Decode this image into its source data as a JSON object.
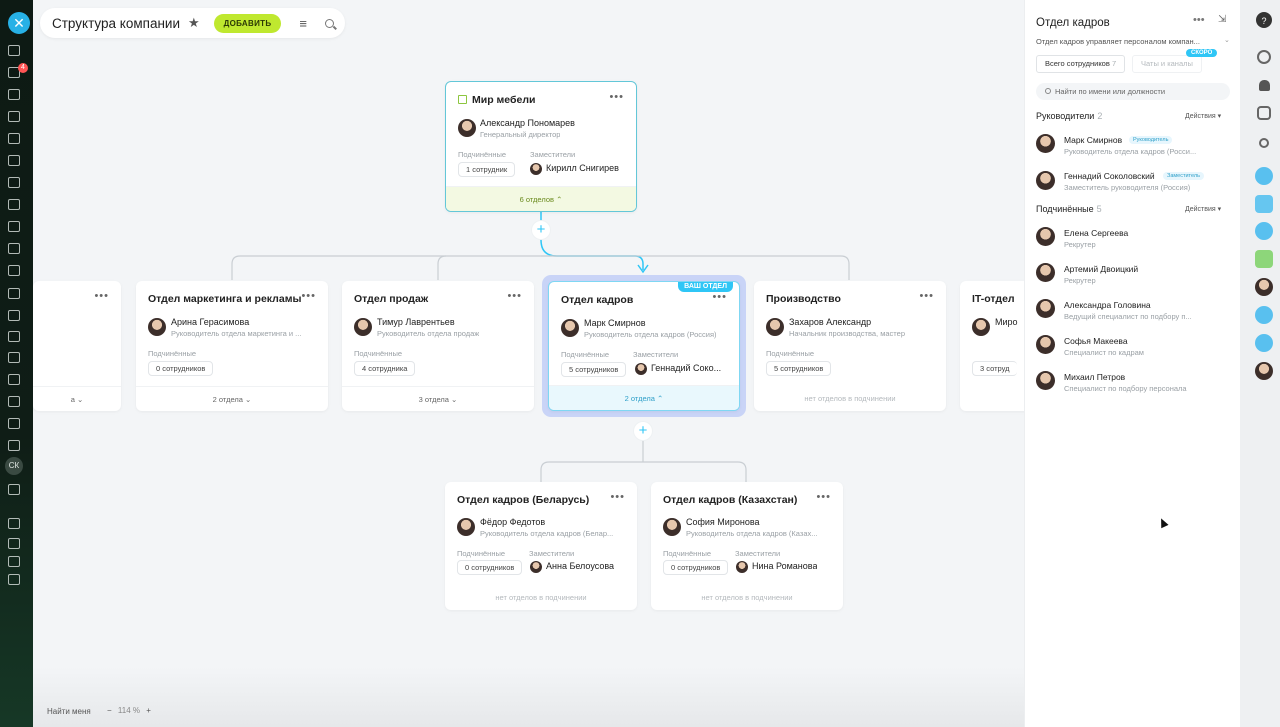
{
  "header": {
    "title": "Структура компании",
    "add_label": "ДОБАВИТЬ"
  },
  "cards": {
    "root": {
      "title": "Мир мебели",
      "head_name": "Александр Пономарев",
      "head_role": "Генеральный директор",
      "subs_label": "Подчинённые",
      "subs_value": "1 сотрудник",
      "deputy_label": "Заместители",
      "deputy_name": "Кирилл Снигирев",
      "footer": "6 отделов"
    },
    "partial": {
      "footer": "а"
    },
    "marketing": {
      "title": "Отдел маркетинга и рекламы",
      "head_name": "Арина Герасимова",
      "head_role": "Руководитель отдела маркетинга и ...",
      "subs_label": "Подчинённые",
      "subs_value": "0 сотрудников",
      "footer": "2 отдела"
    },
    "sales": {
      "title": "Отдел продаж",
      "head_name": "Тимур Лаврентьев",
      "head_role": "Руководитель отдела продаж",
      "subs_label": "Подчинённые",
      "subs_value": "4 сотрудника",
      "footer": "3 отдела"
    },
    "hr": {
      "badge": "ВАШ ОТДЕЛ",
      "title": "Отдел кадров",
      "head_name": "Марк Смирнов",
      "head_role": "Руководитель отдела кадров (Россия)",
      "subs_label": "Подчинённые",
      "subs_value": "5 сотрудников",
      "deputy_label": "Заместители",
      "deputy_name": "Геннадий Соко...",
      "footer": "2 отдела"
    },
    "production": {
      "title": "Производство",
      "head_name": "Захаров Александр",
      "head_role": "Начальник производства, мастер",
      "subs_label": "Подчинённые",
      "subs_value": "5 сотрудников",
      "footer": "нет отделов в подчинении"
    },
    "it": {
      "title": "IT-отдел",
      "head_name": "Миро",
      "subs_value": "3 сотруд"
    },
    "hr_by": {
      "title": "Отдел кадров (Беларусь)",
      "head_name": "Фёдор Федотов",
      "head_role": "Руководитель отдела кадров (Белар...",
      "subs_label": "Подчинённые",
      "subs_value": "0 сотрудников",
      "deputy_label": "Заместители",
      "deputy_name": "Анна Белоусова",
      "footer": "нет отделов в подчинении"
    },
    "hr_kz": {
      "title": "Отдел кадров (Казахстан)",
      "head_name": "София Миронова",
      "head_role": "Руководитель отдела кадров (Казах...",
      "subs_label": "Подчинённые",
      "subs_value": "0 сотрудников",
      "deputy_label": "Заместители",
      "deputy_name": "Нина Романова",
      "footer": "нет отделов в подчинении"
    }
  },
  "bottom": {
    "find_me": "Найти меня",
    "zoom_minus": "−",
    "zoom_value": "114 %",
    "zoom_plus": "+"
  },
  "left_rail": {
    "badge_count": "4",
    "user_initials": "СК"
  },
  "panel": {
    "title": "Отдел кадров",
    "description": "Отдел кадров управляет персоналом компан...",
    "tab_all": "Всего сотрудников",
    "tab_all_count": "7",
    "tab_chats": "Чаты и каналы",
    "soon_badge": "СКОРО",
    "search_placeholder": "Найти по имени или должности",
    "managers_label": "Руководители",
    "managers_count": "2",
    "actions_label": "Действия",
    "subordinates_label": "Подчинённые",
    "subordinates_count": "5",
    "managers": [
      {
        "name": "Марк Смирнов",
        "badge": "Руководитель",
        "role": "Руководитель отдела кадров (Росси..."
      },
      {
        "name": "Геннадий Соколовский",
        "badge": "Заместитель",
        "role": "Заместитель руководителя (Россия)"
      }
    ],
    "subordinates": [
      {
        "name": "Елена Сергеева",
        "role": "Рекрутер"
      },
      {
        "name": "Артемий Двоицкий",
        "role": "Рекрутер"
      },
      {
        "name": "Александра Головина",
        "role": "Ведущий специалист по подбору п..."
      },
      {
        "name": "Софья Макеева",
        "role": "Специалист по кадрам"
      },
      {
        "name": "Михаил Петров",
        "role": "Специалист по подбору персонала"
      }
    ]
  },
  "colors": {
    "accent": "#2fc6f6",
    "add_button": "#bfe82f",
    "root_border": "#63c7d8",
    "hr_highlight": "#c9d4f7"
  }
}
